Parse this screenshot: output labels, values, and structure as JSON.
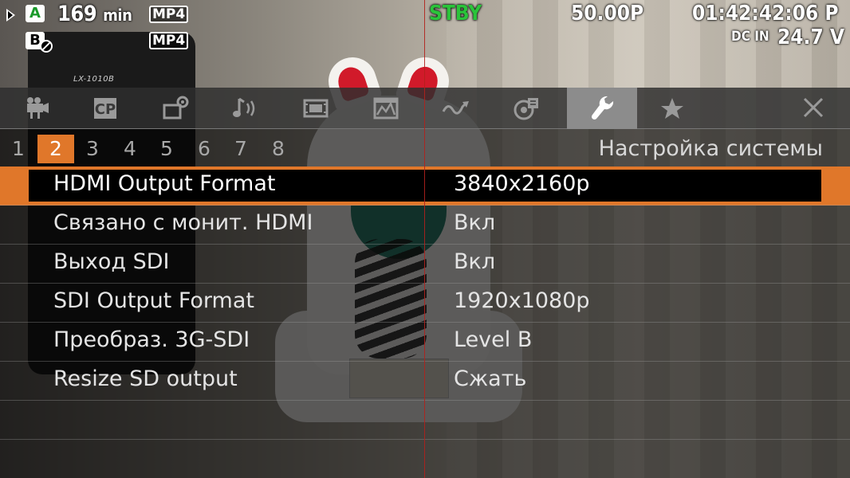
{
  "osd": {
    "slot_a": "A",
    "slot_b": "B",
    "remaining_value": "169",
    "remaining_unit": "min",
    "format_a": "MP4",
    "format_b": "MP4",
    "status": "STBY",
    "frame_rate": "50.00P",
    "timecode": "01:42:42:06 P",
    "power_source": "DC IN",
    "voltage": "24.7 V"
  },
  "background": {
    "monitor_label": "LX-1010B"
  },
  "tabs": [
    {
      "icon": "camera-icon",
      "active": false
    },
    {
      "icon": "cp-icon",
      "label": "CP",
      "active": false
    },
    {
      "icon": "camera-settings-icon",
      "active": false
    },
    {
      "icon": "audio-icon",
      "active": false
    },
    {
      "icon": "video-icon",
      "active": false
    },
    {
      "icon": "assistance-icon",
      "active": false
    },
    {
      "icon": "network-icon",
      "active": false
    },
    {
      "icon": "recording-media-icon",
      "active": false
    },
    {
      "icon": "wrench-icon",
      "active": true
    },
    {
      "icon": "star-icon",
      "active": false
    },
    {
      "icon": "close-icon",
      "active": false
    }
  ],
  "pages": {
    "numbers": [
      "1",
      "2",
      "3",
      "4",
      "5",
      "6",
      "7",
      "8"
    ],
    "active": 2,
    "section_title": "Настройка системы"
  },
  "settings": [
    {
      "label": "HDMI Output Format",
      "value": "3840x2160p",
      "selected": true
    },
    {
      "label": "Связано с монит. HDMI",
      "value": "Вкл",
      "selected": false
    },
    {
      "label": "Выход SDI",
      "value": "Вкл",
      "selected": false
    },
    {
      "label": "SDI Output Format",
      "value": "1920x1080p",
      "selected": false
    },
    {
      "label": "Преобраз. 3G-SDI",
      "value": "Level B",
      "selected": false
    },
    {
      "label": "Resize SD output",
      "value": "Сжать",
      "selected": false
    }
  ],
  "colors": {
    "accent": "#e0772a",
    "status_stby": "#2ac43a",
    "center_line": "#b3201c"
  }
}
